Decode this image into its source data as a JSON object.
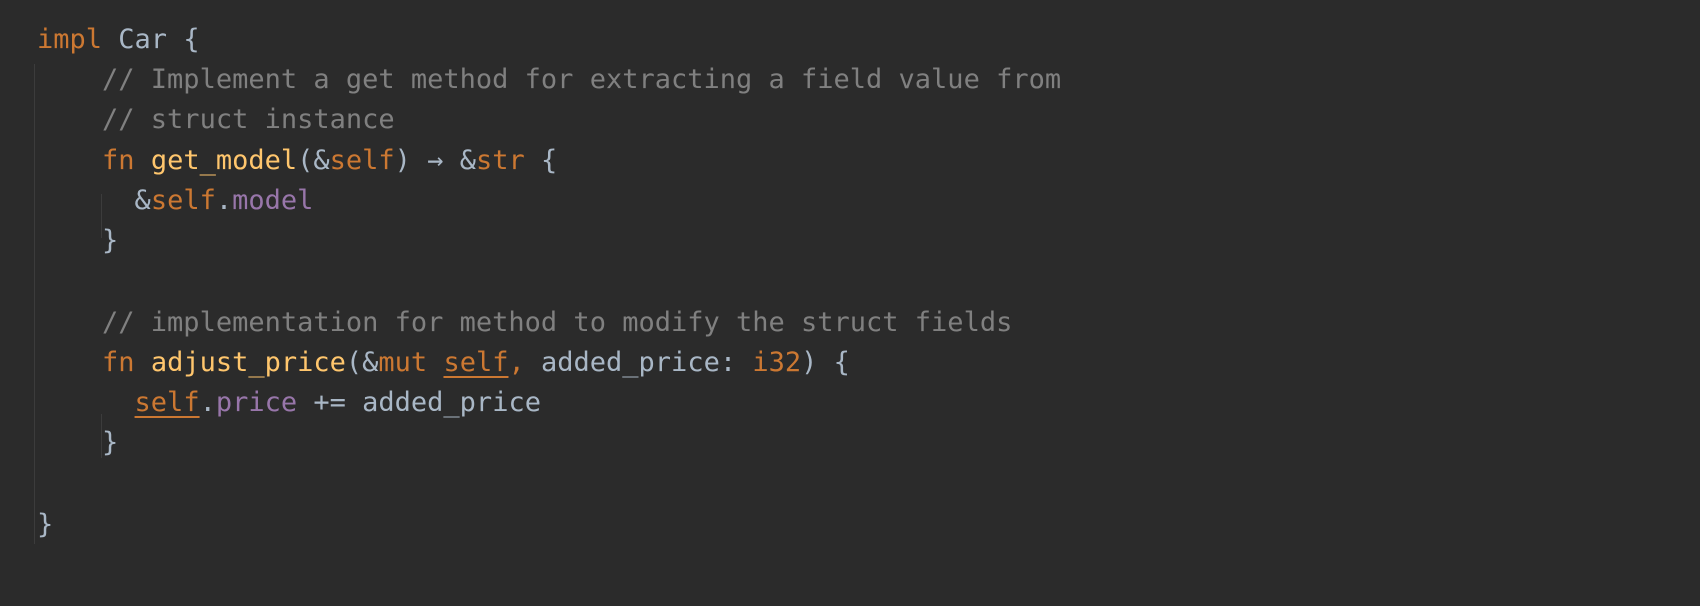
{
  "code": {
    "language": "rust",
    "colors": {
      "background": "#2b2b2b",
      "keyword": "#cc7832",
      "function": "#ffc66d",
      "comment": "#808080",
      "field": "#9876aa",
      "plain": "#a9b7c6"
    },
    "l1": {
      "kw": "impl",
      "name": "Car",
      "brace": "{"
    },
    "l2": {
      "comment": "// Implement a get method for extracting a field value from"
    },
    "l3": {
      "comment": "// struct instance"
    },
    "l4": {
      "kw": "fn",
      "name": "get_model",
      "open": "(&",
      "self": "self",
      "arrow": ") → &",
      "ret": "str",
      "brace": "{"
    },
    "l5": {
      "amp": "&",
      "self": "self",
      "dot": ".",
      "field": "model"
    },
    "l6": {
      "brace": "}"
    },
    "l8": {
      "comment": "// implementation for method to modify the struct fields"
    },
    "l9": {
      "kw": "fn",
      "name": "adjust_price",
      "open": "(&",
      "mut": "mut",
      "self": "self",
      "comma": ",",
      "param": "added_price: ",
      "type": "i32",
      "close": ") {"
    },
    "l10": {
      "self": "self",
      "dot": ".",
      "field": "price",
      "rest": " += added_price"
    },
    "l11": {
      "brace": "}"
    },
    "l13": {
      "brace": "}"
    }
  }
}
